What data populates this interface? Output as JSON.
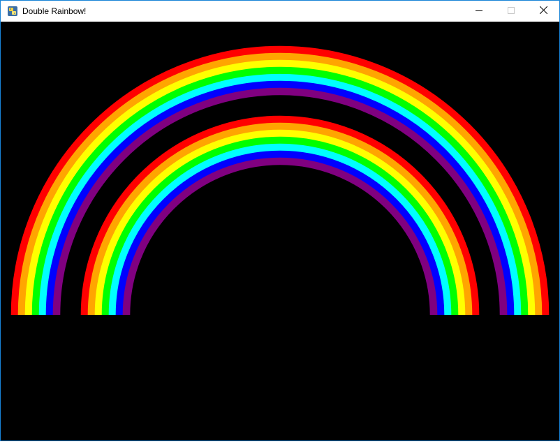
{
  "window": {
    "title": "Double Rainbow!",
    "icon": "python-icon",
    "controls": [
      "minimize-icon",
      "maximize-icon",
      "close-icon"
    ]
  },
  "canvas": {
    "background": "#000000"
  },
  "rainbows": {
    "band_colors": [
      "#ff0000",
      "#ffa500",
      "#ffff00",
      "#00ff00",
      "#00ffff",
      "#0000ff",
      "#800080"
    ],
    "count": 2
  }
}
